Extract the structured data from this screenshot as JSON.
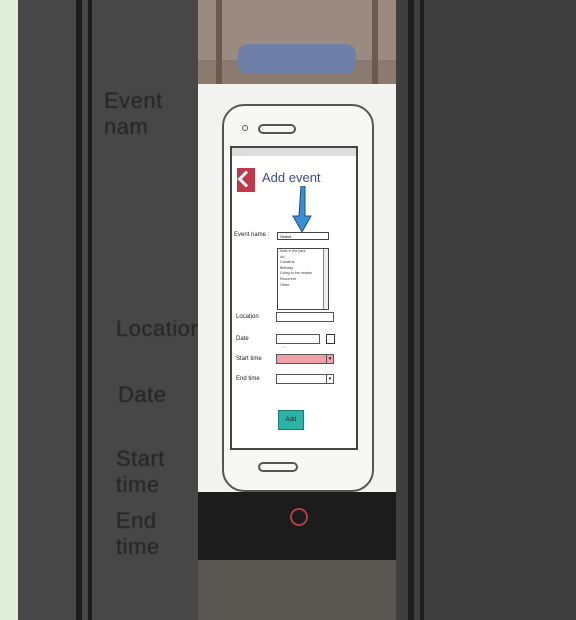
{
  "background": {
    "left_labels": [
      "Event nam",
      "Location",
      "Date",
      "Start time",
      "End time"
    ]
  },
  "app": {
    "title": "Add event",
    "form": {
      "event_name_label": "Event name :",
      "event_name_select": "Select",
      "event_name_options": [
        "Note in the park",
        "Art",
        "Concerts",
        "Birthday",
        "Going to the movies",
        "Recurrent",
        "Other"
      ],
      "location_label": "Location",
      "date_label": "Date",
      "date_value": "- -/- -",
      "start_time_label": "Start time",
      "end_time_label": "End time"
    },
    "add_button": "Add"
  },
  "colors": {
    "accent": "#c0384a",
    "title": "#3b4a9c",
    "button": "#2bb3a6",
    "start_time_field": "#f2a0a8",
    "arrow": "#3a8ed8"
  }
}
